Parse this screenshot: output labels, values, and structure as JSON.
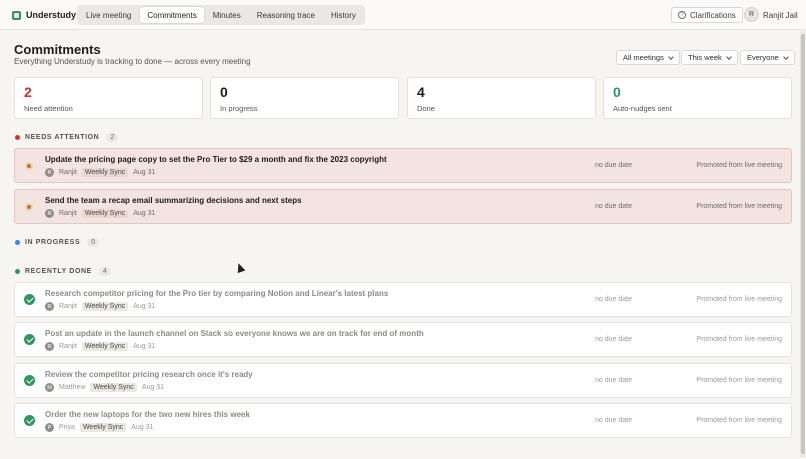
{
  "app": {
    "name": "Understudy"
  },
  "tabs": [
    {
      "label": "Live meeting"
    },
    {
      "label": "Commitments"
    },
    {
      "label": "Minutes"
    },
    {
      "label": "Reasoning trace"
    },
    {
      "label": "History"
    }
  ],
  "header_right": {
    "clarifications": "Clarifications",
    "user_initial": "R",
    "user_name": "Ranjit Jail"
  },
  "page": {
    "title": "Commitments",
    "subtitle": "Everything Understudy is tracking to done — across every meeting"
  },
  "filters": {
    "meetings": "All meetings",
    "range": "This week",
    "people": "Everyone"
  },
  "stats": [
    {
      "value": "2",
      "label": "Need attention",
      "color": "#c0392b"
    },
    {
      "value": "0",
      "label": "In progress",
      "color": "#1d1d1b"
    },
    {
      "value": "4",
      "label": "Done",
      "color": "#1d1d1b"
    },
    {
      "value": "0",
      "label": "Auto-nudges sent",
      "color": "#2f9560"
    }
  ],
  "sections": {
    "attention": {
      "label": "NEEDS ATTENTION",
      "count": "2",
      "color": "#c0392b"
    },
    "progress": {
      "label": "IN PROGRESS",
      "count": "0",
      "color": "#3b82f6"
    },
    "done": {
      "label": "RECENTLY DONE",
      "count": "4",
      "color": "#2f9560"
    }
  },
  "attention_items": [
    {
      "title": "Update the pricing page copy to set the Pro Tier to $29 a month and fix the 2023 copyright",
      "initial": "R",
      "owner": "Ranjit",
      "meeting": "Weekly Sync",
      "date": "Aug 31",
      "due": "no due date",
      "source": "Promoted from live meeting"
    },
    {
      "title": "Send the team a recap email summarizing decisions and next steps",
      "initial": "R",
      "owner": "Ranjit",
      "meeting": "Weekly Sync",
      "date": "Aug 31",
      "due": "no due date",
      "source": "Promoted from live meeting"
    }
  ],
  "done_items": [
    {
      "title": "Research competitor pricing for the Pro tier by comparing Notion and Linear's latest plans",
      "initial": "R",
      "owner": "Ranjit",
      "meeting": "Weekly Sync",
      "date": "Aug 31",
      "due": "no due date",
      "source": "Promoted from live meeting"
    },
    {
      "title": "Post an update in the launch channel on Slack so everyone knows we are on track for end of month",
      "initial": "R",
      "owner": "Ranjit",
      "meeting": "Weekly Sync",
      "date": "Aug 31",
      "due": "no due date",
      "source": "Promoted from live meeting"
    },
    {
      "title": "Review the competitor pricing research once it's ready",
      "initial": "M",
      "owner": "Matthew",
      "meeting": "Weekly Sync",
      "date": "Aug 31",
      "due": "no due date",
      "source": "Promoted from live meeting"
    },
    {
      "title": "Order the new laptops for the two new hires this week",
      "initial": "P",
      "owner": "Priya",
      "meeting": "Weekly Sync",
      "date": "Aug 31",
      "due": "no due date",
      "source": "Promoted from live meeting"
    }
  ]
}
